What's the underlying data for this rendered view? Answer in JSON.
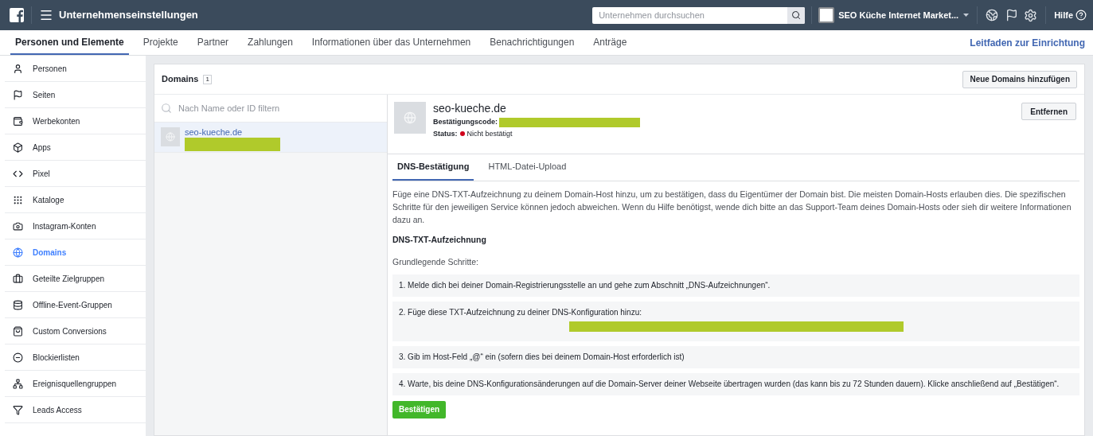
{
  "topbar": {
    "title": "Unternehmenseinstellungen",
    "search": {
      "placeholder": "Unternehmen durchsuchen"
    },
    "account": "SEO Küche Internet Market...",
    "help": "Hilfe"
  },
  "nav": {
    "tabs": [
      {
        "label": "Personen und Elemente",
        "selected": true
      },
      {
        "label": "Projekte",
        "selected": false
      },
      {
        "label": "Partner",
        "selected": false
      },
      {
        "label": "Zahlungen",
        "selected": false
      },
      {
        "label": "Informationen über das Unternehmen",
        "selected": false
      },
      {
        "label": "Benachrichtigungen",
        "selected": false
      },
      {
        "label": "Anträge",
        "selected": false
      }
    ],
    "guide_link": "Leitfaden zur Einrichtung"
  },
  "sidebar": {
    "items": [
      {
        "label": "Personen",
        "selected": false
      },
      {
        "label": "Seiten",
        "selected": false
      },
      {
        "label": "Werbekonten",
        "selected": false
      },
      {
        "label": "Apps",
        "selected": false
      },
      {
        "label": "Pixel",
        "selected": false
      },
      {
        "label": "Kataloge",
        "selected": false
      },
      {
        "label": "Instagram-Konten",
        "selected": false
      },
      {
        "label": "Domains",
        "selected": true
      },
      {
        "label": "Geteilte Zielgruppen",
        "selected": false
      },
      {
        "label": "Offline-Event-Gruppen",
        "selected": false
      },
      {
        "label": "Custom Conversions",
        "selected": false
      },
      {
        "label": "Blockierlisten",
        "selected": false
      },
      {
        "label": "Ereignisquellengruppen",
        "selected": false
      },
      {
        "label": "Leads Access",
        "selected": false
      }
    ]
  },
  "panel": {
    "title": "Domains",
    "count": "1",
    "add_button": "Neue Domains hinzufügen",
    "filter": {
      "placeholder": "Nach Name oder ID filtern"
    },
    "list": [
      {
        "name": "seo-kueche.de",
        "selected": true
      }
    ],
    "detail": {
      "name": "seo-kueche.de",
      "code_label": "Bestätigungscode:",
      "status_label": "Status:",
      "status": "Nicht bestätigt",
      "remove_button": "Entfernen",
      "tabs": [
        {
          "label": "DNS-Bestätigung",
          "selected": true
        },
        {
          "label": "HTML-Datei-Upload",
          "selected": false
        }
      ],
      "intro": "Füge eine DNS-TXT-Aufzeichnung zu deinem Domain-Host hinzu, um zu bestätigen, dass du Eigentümer der Domain bist. Die meisten Domain-Hosts erlauben dies. Die spezifischen Schritte für den jeweiligen Service können jedoch abweichen. Wenn du Hilfe benötigst, wende dich bitte an das Support-Team deines Domain-Hosts oder sieh dir weitere Informationen dazu an.",
      "heading": "DNS-TXT-Aufzeichnung",
      "subheading": "Grundlegende Schritte:",
      "steps": [
        {
          "text": "1. Melde dich bei deiner Domain-Registrierungsstelle an und gehe zum Abschnitt „DNS-Aufzeichnungen“.",
          "redacted_value": false
        },
        {
          "text": "2. Füge diese TXT-Aufzeichnung zu deiner DNS-Konfiguration hinzu:",
          "redacted_value": true
        },
        {
          "text": "3. Gib im Host-Feld „@“ ein (sofern dies bei deinem Domain-Host erforderlich ist)",
          "redacted_value": false
        },
        {
          "text": "4. Warte, bis deine DNS-Konfigurationsänderungen auf die Domain-Server deiner Webseite übertragen wurden (das kann bis zu 72 Stunden dauern). Klicke anschließend auf „Bestätigen“.",
          "redacted_value": false
        }
      ],
      "confirm_button": "Bestätigen"
    }
  }
}
